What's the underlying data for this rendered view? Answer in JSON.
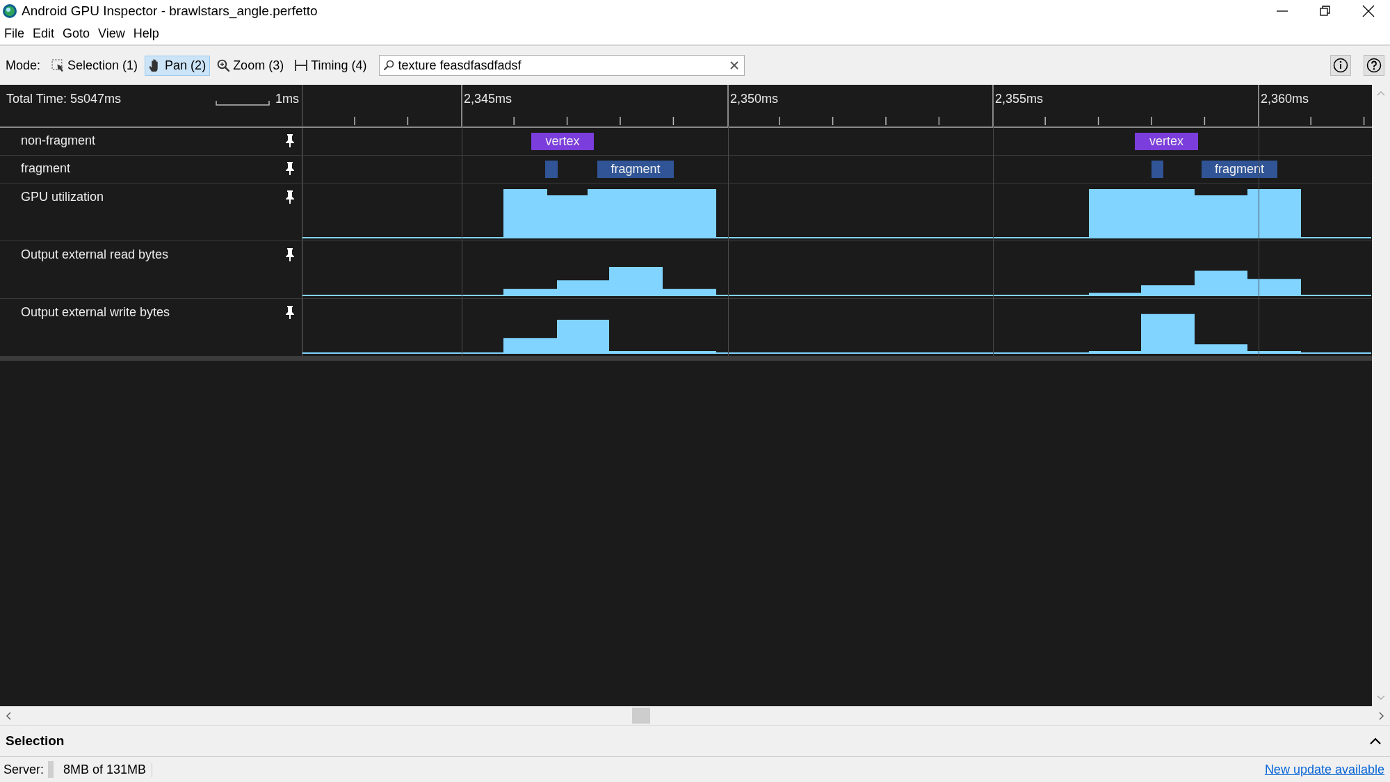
{
  "window": {
    "title": "Android GPU Inspector - brawlstars_angle.perfetto"
  },
  "menu": [
    "File",
    "Edit",
    "Goto",
    "View",
    "Help"
  ],
  "toolbar": {
    "mode_label": "Mode:",
    "modes": [
      {
        "kind": "selection",
        "label": "Selection (1)",
        "selected": false
      },
      {
        "kind": "pan",
        "label": "Pan (2)",
        "selected": true
      },
      {
        "kind": "zoom",
        "label": "Zoom (3)",
        "selected": false
      },
      {
        "kind": "timing",
        "label": "Timing (4)",
        "selected": false
      }
    ],
    "search": {
      "value": "texture feasdfasdfadsf"
    }
  },
  "timeline": {
    "total_time": "Total Time: 5s047ms",
    "scale": "1ms",
    "ticks": [
      "2,345ms",
      "2,350ms",
      "2,355ms",
      "2,360ms"
    ],
    "tracks": [
      {
        "kind": "slices",
        "name": "non-fragment",
        "color": "#7b3ddb",
        "slices": [
          {
            "kind": "labeled",
            "label": "vertex"
          },
          {
            "kind": "labeled",
            "label": "vertex"
          }
        ]
      },
      {
        "kind": "slices",
        "name": "fragment",
        "color": "#305496",
        "slices": [
          {
            "kind": "unlabeled"
          },
          {
            "kind": "labeled",
            "label": "fragment"
          },
          {
            "kind": "unlabeled"
          },
          {
            "kind": "labeled",
            "label": "fragment"
          }
        ]
      },
      {
        "kind": "counter",
        "name": "GPU utilization"
      },
      {
        "kind": "counter",
        "name": "Output external read bytes"
      },
      {
        "kind": "counter",
        "name": "Output external write bytes"
      }
    ]
  },
  "selection_panel": {
    "title": "Selection"
  },
  "status_bar": {
    "server_label": "Server:",
    "memory": "8MB of 131MB",
    "update_link": "New update available"
  }
}
